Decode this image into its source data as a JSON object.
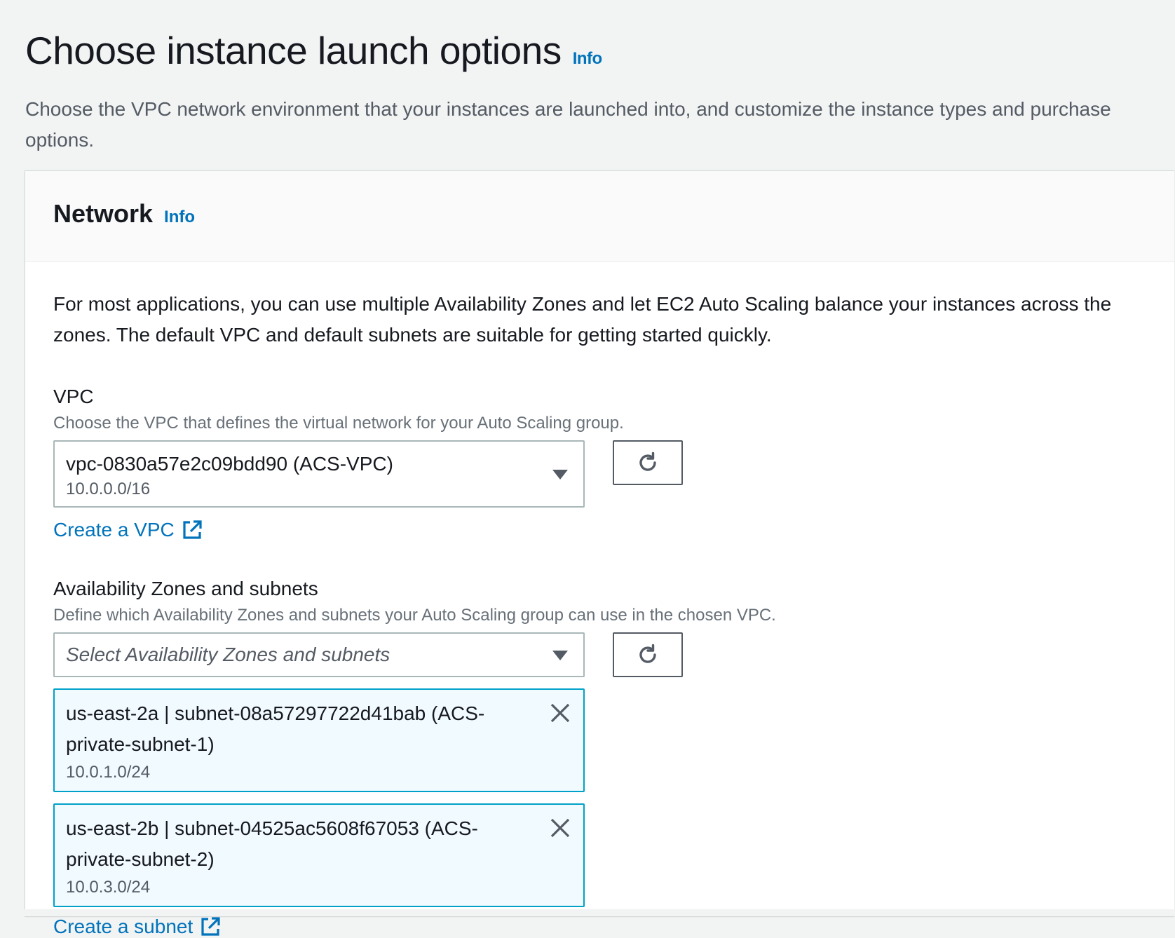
{
  "page": {
    "title": "Choose instance launch options",
    "info_label": "Info",
    "description": "Choose the VPC network environment that your instances are launched into, and customize the instance types and purchase options."
  },
  "network": {
    "title": "Network",
    "info_label": "Info",
    "intro": "For most applications, you can use multiple Availability Zones and let EC2 Auto Scaling balance your instances across the zones. The default VPC and default subnets are suitable for getting started quickly.",
    "vpc": {
      "label": "VPC",
      "description": "Choose the VPC that defines the virtual network for your Auto Scaling group.",
      "selected_value": "vpc-0830a57e2c09bdd90 (ACS-VPC)",
      "selected_cidr": "10.0.0.0/16",
      "create_link": "Create a VPC"
    },
    "azs": {
      "label": "Availability Zones and subnets",
      "description": "Define which Availability Zones and subnets your Auto Scaling group can use in the chosen VPC.",
      "placeholder": "Select Availability Zones and subnets",
      "tokens": [
        {
          "text": "us-east-2a | subnet-08a57297722d41bab (ACS-private-subnet-1)",
          "cidr": "10.0.1.0/24"
        },
        {
          "text": "us-east-2b | subnet-04525ac5608f67053 (ACS-private-subnet-2)",
          "cidr": "10.0.3.0/24"
        }
      ],
      "create_link": "Create a subnet"
    }
  },
  "icons": {
    "refresh": "refresh-icon",
    "caret": "caret-down-icon",
    "external": "external-link-icon",
    "dismiss": "close-icon"
  },
  "colors": {
    "link": "#0073bb",
    "token_bg": "#f1faff",
    "token_border": "#00a1c9"
  }
}
